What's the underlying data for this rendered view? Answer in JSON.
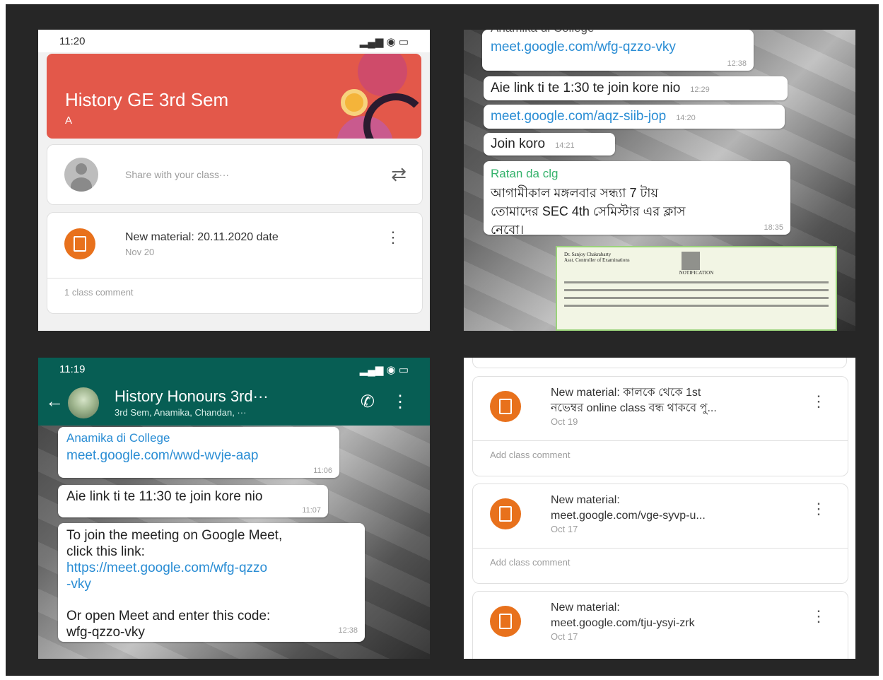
{
  "panel1": {
    "status": {
      "time": "11:20",
      "icons": "▂▄▆ ◉ ▭"
    },
    "banner": {
      "title": "History GE 3rd Sem",
      "subtitle": "A"
    },
    "share_placeholder": "Share with your class···",
    "material": {
      "title": "New material: 20.11.2020 date",
      "date": "Nov 20",
      "comment": "1 class comment"
    }
  },
  "panel2": {
    "bubbles": [
      {
        "sender": "Anamika di College",
        "text": "meet.google.com/wfg-qzzo-vky",
        "time": "12:38"
      },
      {
        "text": "Aie link ti te 1:30 te join kore nio",
        "time": "12:29"
      },
      {
        "text": "meet.google.com/aqz-siib-jop",
        "time": "14:20"
      },
      {
        "text": "Join koro",
        "time": "14:21"
      },
      {
        "sender": "Ratan da clg",
        "line1": "আগামীকাল মঙ্গলবার সন্ধ্যা 7 টায়",
        "line2": "তোমাদের SEC 4th সেমিস্টার এর ক্লাস",
        "line3": "নেবো।",
        "time": "18:35"
      }
    ],
    "document": {
      "header_left": "Dr. Sanjoy Chakrabarty",
      "header_sub": "Asst. Controller of Examinations",
      "heading": "NOTIFICATION"
    }
  },
  "panel3": {
    "status": {
      "time": "11:19",
      "icons": "▂▄▆ ◉ ▭"
    },
    "header": {
      "name": "History Honours 3rd···",
      "subtitle": "3rd Sem, Anamika, Chandan, ···"
    },
    "bubbles": [
      {
        "sender": "Anamika di College",
        "text": "meet.google.com/wwd-wvje-aap",
        "time": "11:06"
      },
      {
        "text": "Aie link ti te 11:30 te join kore nio",
        "time": "11:07"
      },
      {
        "line1": "To join the meeting on Google Meet,",
        "line2": "click this link:",
        "link1": "https://meet.google.com/wfg-qzzo",
        "link2": "-vky",
        "line3": "Or open Meet and enter this code:",
        "line4": "wfg-qzzo-vky",
        "time": "12:38"
      }
    ]
  },
  "panel4": {
    "materials": [
      {
        "line1": "New material: কালকে থেকে 1st",
        "line2": "নভেম্বর online class বন্ধ থাকবে পু...",
        "date": "Oct 19",
        "comment": "Add class comment"
      },
      {
        "line1": "New material:",
        "line2": "meet.google.com/vge-syvp-u...",
        "date": "Oct 17",
        "comment": "Add class comment"
      },
      {
        "line1": "New material:",
        "line2": "meet.google.com/tju-ysyi-zrk",
        "date": "Oct 17"
      }
    ]
  }
}
